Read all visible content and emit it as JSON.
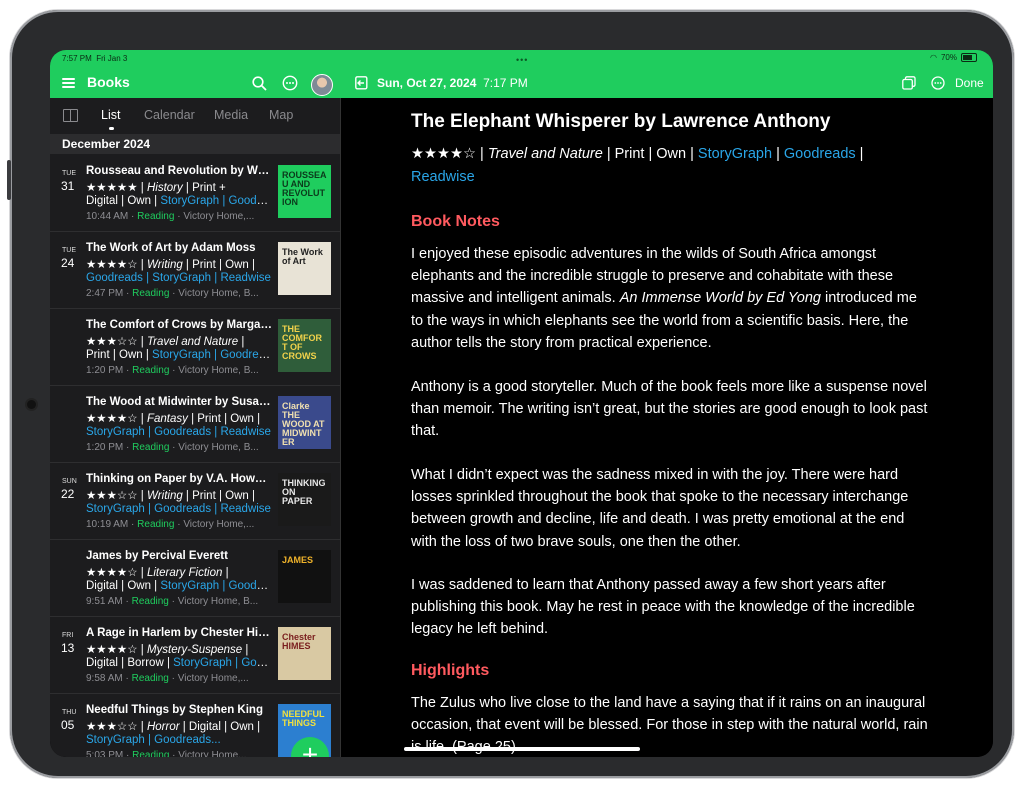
{
  "status": {
    "time": "7:57 PM",
    "date": "Fri Jan 3",
    "battery": "70%"
  },
  "sidebar": {
    "title": "Books",
    "tabs": [
      "List",
      "Calendar",
      "Media",
      "Map"
    ],
    "section": "December 2024",
    "items": [
      {
        "dow": "TUE",
        "day": "31",
        "title": "Rousseau and Revolution by Will Durant",
        "rating": "★★★★★",
        "l2a": " | ",
        "genre": "History",
        "l2b": " | Print +",
        "l3": "Digital | Own | ",
        "links": "StoryGraph | Goodreads",
        "time": "10:44 AM",
        "status": "Reading",
        "place": "Victory Home,..."
      },
      {
        "dow": "TUE",
        "day": "24",
        "title": "The Work of Art by Adam Moss",
        "rating": "★★★★☆",
        "l2a": " | ",
        "genre": "Writing",
        "l2b": " | Print | Own |",
        "l3": "",
        "links": "Goodreads | StoryGraph | Readwise",
        "time": "2:47 PM",
        "status": "Reading",
        "place": "Victory Home, B..."
      },
      {
        "dow": "",
        "day": "",
        "title": "The Comfort of Crows by Margaret Renkl",
        "rating": "★★★☆☆",
        "l2a": " | ",
        "genre": "Travel and Nature",
        "l2b": " |",
        "l3": "Print | Own | ",
        "links": "StoryGraph | Goodreads",
        "time": "1:20 PM",
        "status": "Reading",
        "place": "Victory Home, B..."
      },
      {
        "dow": "",
        "day": "",
        "title": "The Wood at Midwinter by Susanna Clarke",
        "rating": "★★★★☆",
        "l2a": " | ",
        "genre": "Fantasy",
        "l2b": " | Print | Own |",
        "l3": "",
        "links": "StoryGraph | Goodreads | Readwise",
        "time": "1:20 PM",
        "status": "Reading",
        "place": "Victory Home, B..."
      },
      {
        "dow": "SUN",
        "day": "22",
        "title": "Thinking on Paper by V.A. Howard",
        "rating": "★★★☆☆",
        "l2a": " | ",
        "genre": "Writing",
        "l2b": " | Print | Own |",
        "l3": "",
        "links": "StoryGraph | Goodreads | Readwise",
        "time": "10:19 AM",
        "status": "Reading",
        "place": "Victory Home,..."
      },
      {
        "dow": "",
        "day": "",
        "title": "James by Percival Everett",
        "rating": "★★★★☆",
        "l2a": " | ",
        "genre": "Literary Fiction",
        "l2b": " |",
        "l3": "Digital | Own | ",
        "links": "StoryGraph | Goodreads",
        "time": "9:51 AM",
        "status": "Reading",
        "place": "Victory Home, B..."
      },
      {
        "dow": "FRI",
        "day": "13",
        "title": "A Rage in Harlem by Chester Himes",
        "rating": "★★★★☆",
        "l2a": " | ",
        "genre": "Mystery-Suspense",
        "l2b": " |",
        "l3": "Digital | Borrow | ",
        "links": "StoryGraph | Goodreads",
        "time": "9:58 AM",
        "status": "Reading",
        "place": "Victory Home,..."
      },
      {
        "dow": "THU",
        "day": "05",
        "title": "Needful Things by Stephen King",
        "rating": "★★★☆☆",
        "l2a": " | ",
        "genre": "Horror",
        "l2b": " | Digital | Own |",
        "l3": "",
        "links": "StoryGraph | Goodreads...",
        "time": "5:03 PM",
        "status": "Reading",
        "place": "Victory Home..."
      }
    ],
    "covers": [
      {
        "bg": "#1fcd5e",
        "fg": "#0b3b1c",
        "text": "ROUSSEAU AND REVOLUTION"
      },
      {
        "bg": "#e8e3d6",
        "fg": "#222222",
        "text": "The Work of Art"
      },
      {
        "bg": "#2f5d3a",
        "fg": "#f2d24b",
        "text": "THE COMFORT OF CROWS"
      },
      {
        "bg": "#3a4a8c",
        "fg": "#f0e0b0",
        "text": "Clarke THE WOOD AT MIDWINTER"
      },
      {
        "bg": "#1a1a1a",
        "fg": "#e8e8e8",
        "text": "THINKING ON PAPER"
      },
      {
        "bg": "#111111",
        "fg": "#f0b32a",
        "text": "JAMES"
      },
      {
        "bg": "#d9c9a3",
        "fg": "#7a1e1e",
        "text": "Chester HIMES"
      },
      {
        "bg": "#2c7fd0",
        "fg": "#f0e040",
        "text": "NEEDFUL THINGS"
      }
    ]
  },
  "detail": {
    "date": "Sun, Oct 27, 2024",
    "time": "7:17 PM",
    "done": "Done",
    "title": "The Elephant Whisperer by Lawrence Anthony",
    "rating": "★★★★☆",
    "sub_sep1": " | ",
    "genre": "Travel and Nature",
    "sub_mid": " | Print | Own | ",
    "link1": "StoryGraph",
    "link2": "Goodreads",
    "link3": "Readwise",
    "heading_notes": "Book Notes",
    "p1a": "I enjoyed these episodic adventures in the wilds of South Africa amongst elephants and the incredible struggle to preserve and cohabitate with these massive and intelligent animals.  ",
    "p1b": "An Immense World by Ed Yong",
    "p1c": " introduced me to the ways in which elephants see the world from a scientific basis. Here, the author tells the story from practical experience.",
    "p2": "Anthony is a good storyteller. Much of the book feels more like a suspense novel than memoir. The writing isn’t great, but the stories are good enough to look past that.",
    "p3": "What I didn’t expect was the sadness mixed in with the joy. There were hard losses sprinkled throughout the book that spoke to the necessary interchange between growth and decline, life and death.  I was pretty emotional at the end with the loss of two brave souls, one then the other.",
    "p4": "I was saddened to learn that Anthony passed away a few short years after publishing this book.  May he rest in peace with the knowledge of the incredible legacy he left behind.",
    "heading_highlights": "Highlights",
    "p5": "The Zulus who live close to the land have a saying that if it rains on an inaugural occasion, that event will be blessed. For those in step with the natural world, rain is life. (Page 25)"
  }
}
